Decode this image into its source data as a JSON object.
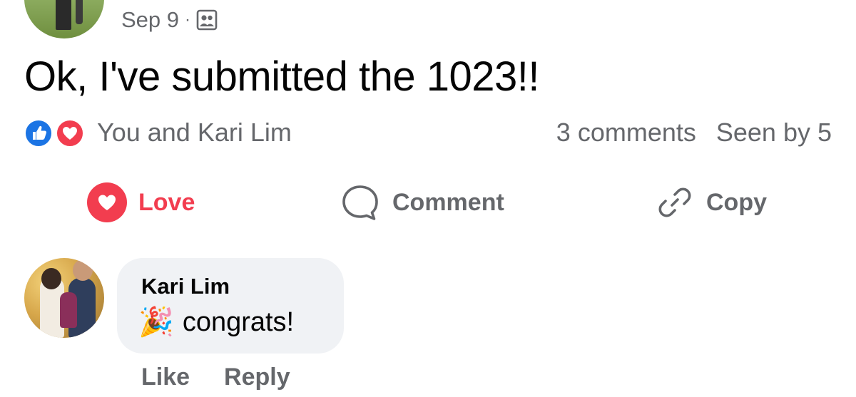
{
  "post": {
    "date": "Sep 9",
    "separator": "·",
    "audience_icon": "audience-icon",
    "text": "Ok, I've submitted the 1023!!"
  },
  "reactions": {
    "icons": [
      "like-icon",
      "love-icon"
    ],
    "reactors_text": "You and Kari Lim",
    "comments_count": "3 comments",
    "seen_by": "Seen by 5"
  },
  "actions": {
    "love_label": "Love",
    "comment_label": "Comment",
    "copy_label": "Copy"
  },
  "comment": {
    "author": "Kari Lim",
    "emoji": "🎉",
    "text": "congrats!",
    "like_label": "Like",
    "reply_label": "Reply"
  },
  "colors": {
    "love_red": "#f23d4f",
    "like_blue": "#1b74e4",
    "muted_text": "#65676b",
    "bubble_bg": "#f0f2f5"
  }
}
